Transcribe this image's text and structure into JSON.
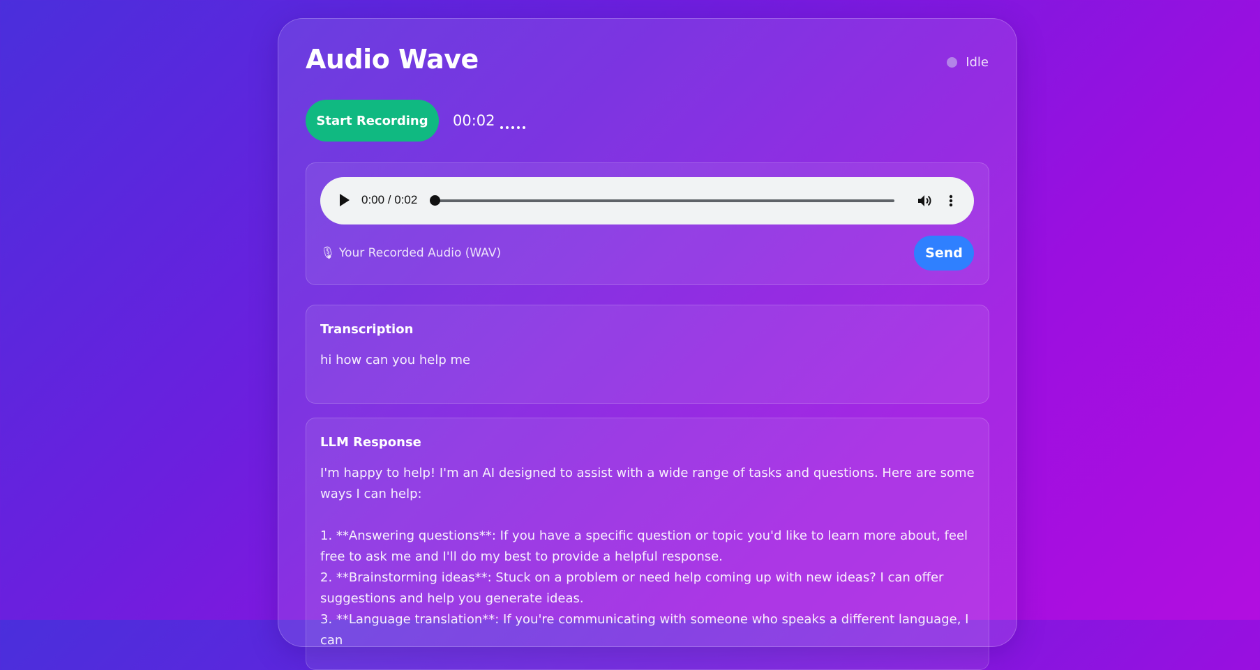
{
  "app": {
    "title": "Audio Wave"
  },
  "status": {
    "label": "Idle"
  },
  "controls": {
    "record_label": "Start Recording",
    "timer": "00:02",
    "dots": "....."
  },
  "audio": {
    "time_display": "0:00 / 0:02",
    "progress": 0,
    "label": "🎙 Your Recorded Audio (WAV)",
    "send_label": "Send"
  },
  "transcription": {
    "heading": "Transcription",
    "text": "hi how can you help me"
  },
  "llm": {
    "heading": "LLM Response",
    "text": "I'm happy to help! I'm an AI designed to assist with a wide range of tasks and questions. Here are some ways I can help:\n\n1. **Answering questions**: If you have a specific question or topic you'd like to learn more about, feel free to ask me and I'll do my best to provide a helpful response.\n2. **Brainstorming ideas**: Stuck on a problem or need help coming up with new ideas? I can offer suggestions and help you generate ideas.\n3. **Language translation**: If you're communicating with someone who speaks a different language, I can"
  },
  "colors": {
    "record_button": "#10b981",
    "send_button": "#2f80ff",
    "status_dot": "#b384e8"
  },
  "icons": {
    "play": "play-icon",
    "volume": "volume-icon",
    "more": "more-vertical-icon",
    "mic": "microphone-icon"
  }
}
